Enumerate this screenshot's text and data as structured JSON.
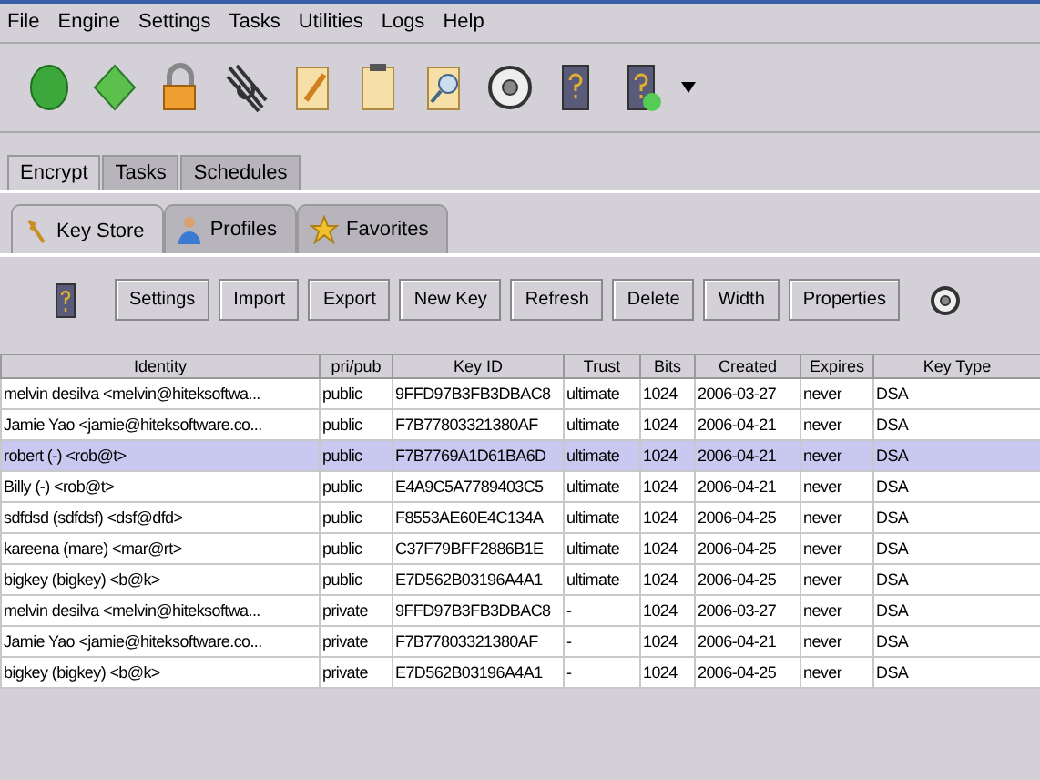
{
  "menu": [
    "File",
    "Engine",
    "Settings",
    "Tasks",
    "Utilities",
    "Logs",
    "Help"
  ],
  "tabs": [
    {
      "label": "Encrypt",
      "selected": true
    },
    {
      "label": "Tasks",
      "selected": false
    },
    {
      "label": "Schedules",
      "selected": false
    }
  ],
  "subtabs": [
    {
      "label": "Key Store",
      "selected": true,
      "kind": "keys"
    },
    {
      "label": "Profiles",
      "selected": false,
      "kind": "person"
    },
    {
      "label": "Favorites",
      "selected": false,
      "kind": "star"
    }
  ],
  "buttons": [
    "Settings",
    "Import",
    "Export",
    "New Key",
    "Refresh",
    "Delete",
    "Width",
    "Properties"
  ],
  "table": {
    "columns": [
      "Identity",
      "pri/pub",
      "Key ID",
      "Trust",
      "Bits",
      "Created",
      "Expires",
      "Key Type"
    ],
    "rows": [
      {
        "selected": false,
        "cells": [
          "melvin desilva <melvin@hiteksoftwa...",
          "public",
          "9FFD97B3FB3DBAC8",
          "ultimate",
          "1024",
          "2006-03-27",
          "never",
          "DSA"
        ]
      },
      {
        "selected": false,
        "cells": [
          "Jamie Yao <jamie@hiteksoftware.co...",
          "public",
          "F7B77803321380AF",
          "ultimate",
          "1024",
          "2006-04-21",
          "never",
          "DSA"
        ]
      },
      {
        "selected": true,
        "cells": [
          "robert (-) <rob@t>",
          "public",
          "F7B7769A1D61BA6D",
          "ultimate",
          "1024",
          "2006-04-21",
          "never",
          "DSA"
        ]
      },
      {
        "selected": false,
        "cells": [
          "Billy (-) <rob@t>",
          "public",
          "E4A9C5A7789403C5",
          "ultimate",
          "1024",
          "2006-04-21",
          "never",
          "DSA"
        ]
      },
      {
        "selected": false,
        "cells": [
          "sdfdsd (sdfdsf) <dsf@dfd>",
          "public",
          "F8553AE60E4C134A",
          "ultimate",
          "1024",
          "2006-04-25",
          "never",
          "DSA"
        ]
      },
      {
        "selected": false,
        "cells": [
          "kareena (mare) <mar@rt>",
          "public",
          "C37F79BFF2886B1E",
          "ultimate",
          "1024",
          "2006-04-25",
          "never",
          "DSA"
        ]
      },
      {
        "selected": false,
        "cells": [
          "bigkey (bigkey) <b@k>",
          "public",
          "E7D562B03196A4A1",
          "ultimate",
          "1024",
          "2006-04-25",
          "never",
          "DSA"
        ]
      },
      {
        "selected": false,
        "cells": [
          "melvin desilva <melvin@hiteksoftwa...",
          "private",
          "9FFD97B3FB3DBAC8",
          "-",
          "1024",
          "2006-03-27",
          "never",
          "DSA"
        ]
      },
      {
        "selected": false,
        "cells": [
          "Jamie Yao <jamie@hiteksoftware.co...",
          "private",
          "F7B77803321380AF",
          "-",
          "1024",
          "2006-04-21",
          "never",
          "DSA"
        ]
      },
      {
        "selected": false,
        "cells": [
          "bigkey (bigkey) <b@k>",
          "private",
          "E7D562B03196A4A1",
          "-",
          "1024",
          "2006-04-25",
          "never",
          "DSA"
        ]
      }
    ]
  }
}
